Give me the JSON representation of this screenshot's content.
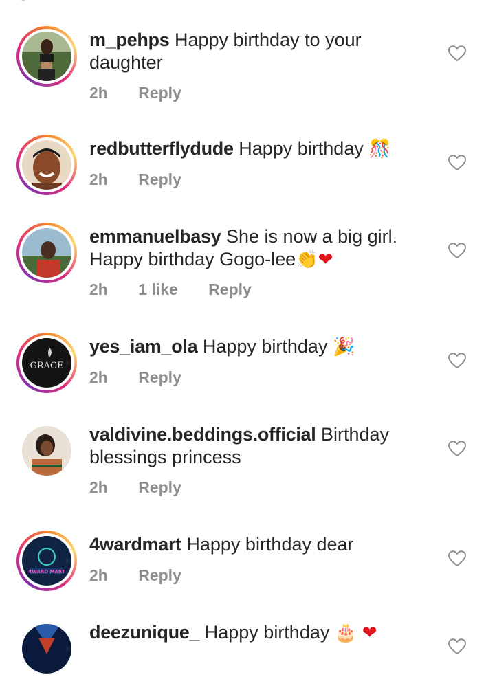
{
  "comments": [
    {
      "username": "m_pehps",
      "text": "Happy birthday to your",
      "text2": "daughter",
      "time": "2h",
      "reply": "Reply",
      "avatar_colors": [
        "#3a4a2c",
        "#6b7b4a",
        "#b7a58a"
      ]
    },
    {
      "username": "redbutterflydude",
      "text": "Happy birthday",
      "emoji": "🎊",
      "time": "2h",
      "reply": "Reply",
      "avatar_colors": [
        "#5a2f1a",
        "#8a4a2a",
        "#d08a5a"
      ]
    },
    {
      "username": "emmanuelbasy",
      "text": "She is now a big girl.",
      "text2": "Happy birthday Gogo-lee",
      "emoji": "👏",
      "emoji2": "❤",
      "time": "2h",
      "likes": "1 like",
      "reply": "Reply",
      "avatar_colors": [
        "#7fa2b9",
        "#c23a2a",
        "#3d2a22"
      ]
    },
    {
      "username": "yes_iam_ola",
      "text": "Happy birthday",
      "emoji": "🎉",
      "time": "2h",
      "reply": "Reply",
      "avatar_text": "GRACE",
      "avatar_colors": [
        "#111111",
        "#333333",
        "#dddddd"
      ]
    },
    {
      "username": "valdivine.beddings.official",
      "text": "Birthday",
      "text2": "blessings princess",
      "time": "2h",
      "reply": "Reply",
      "avatar_colors": [
        "#e8dcd0",
        "#b86a3a",
        "#2a1d18"
      ]
    },
    {
      "username": "4wardmart",
      "text": "Happy birthday dear",
      "time": "2h",
      "reply": "Reply",
      "avatar_text": "4WARD MART",
      "avatar_colors": [
        "#0f2342",
        "#1a3c6a",
        "#e65cc8"
      ]
    },
    {
      "username": "deezunique_",
      "text": "Happy birthday",
      "emoji": "🎂",
      "emoji2": "❤",
      "avatar_colors": [
        "#0a1a3c",
        "#c2402a",
        "#2a5aa8"
      ]
    }
  ]
}
